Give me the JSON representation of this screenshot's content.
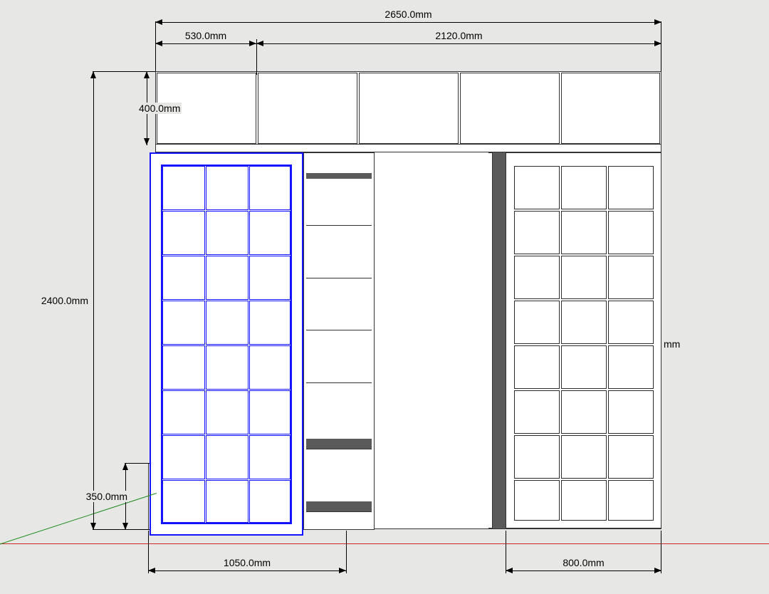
{
  "dims": {
    "total_width": "2650.0mm",
    "upper_left_width": "530.0mm",
    "upper_right_width": "2120.0mm",
    "upper_height": "400.0mm",
    "total_height": "2400.0mm",
    "base_height": "350.0mm",
    "bottom_left_width": "1050.0mm",
    "bottom_right_width": "800.0mm",
    "right_stray": "mm"
  }
}
